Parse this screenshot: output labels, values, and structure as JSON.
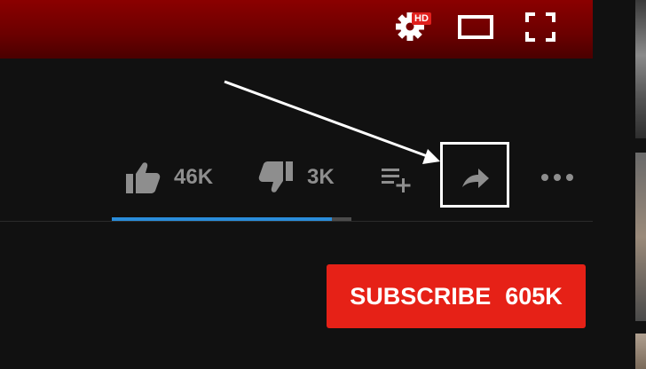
{
  "player": {
    "hd_badge": "HD",
    "icons": [
      "gear-icon",
      "theater-mode-icon",
      "fullscreen-icon"
    ]
  },
  "actions": {
    "like_count": "46K",
    "dislike_count": "3K",
    "icons": [
      "thumbs-up-icon",
      "thumbs-down-icon",
      "add-to-playlist-icon",
      "share-icon",
      "more-icon"
    ]
  },
  "sentiment": {
    "like_fraction": 0.92
  },
  "subscribe": {
    "label": "SUBSCRIBE",
    "count": "605K"
  },
  "colors": {
    "subscribe": "#e62117",
    "sentiment": "#2a8ddb",
    "hd_badge": "#e1201d",
    "player_bar": "#8b0000",
    "background": "#111111",
    "muted_text": "#8e8e8e"
  }
}
